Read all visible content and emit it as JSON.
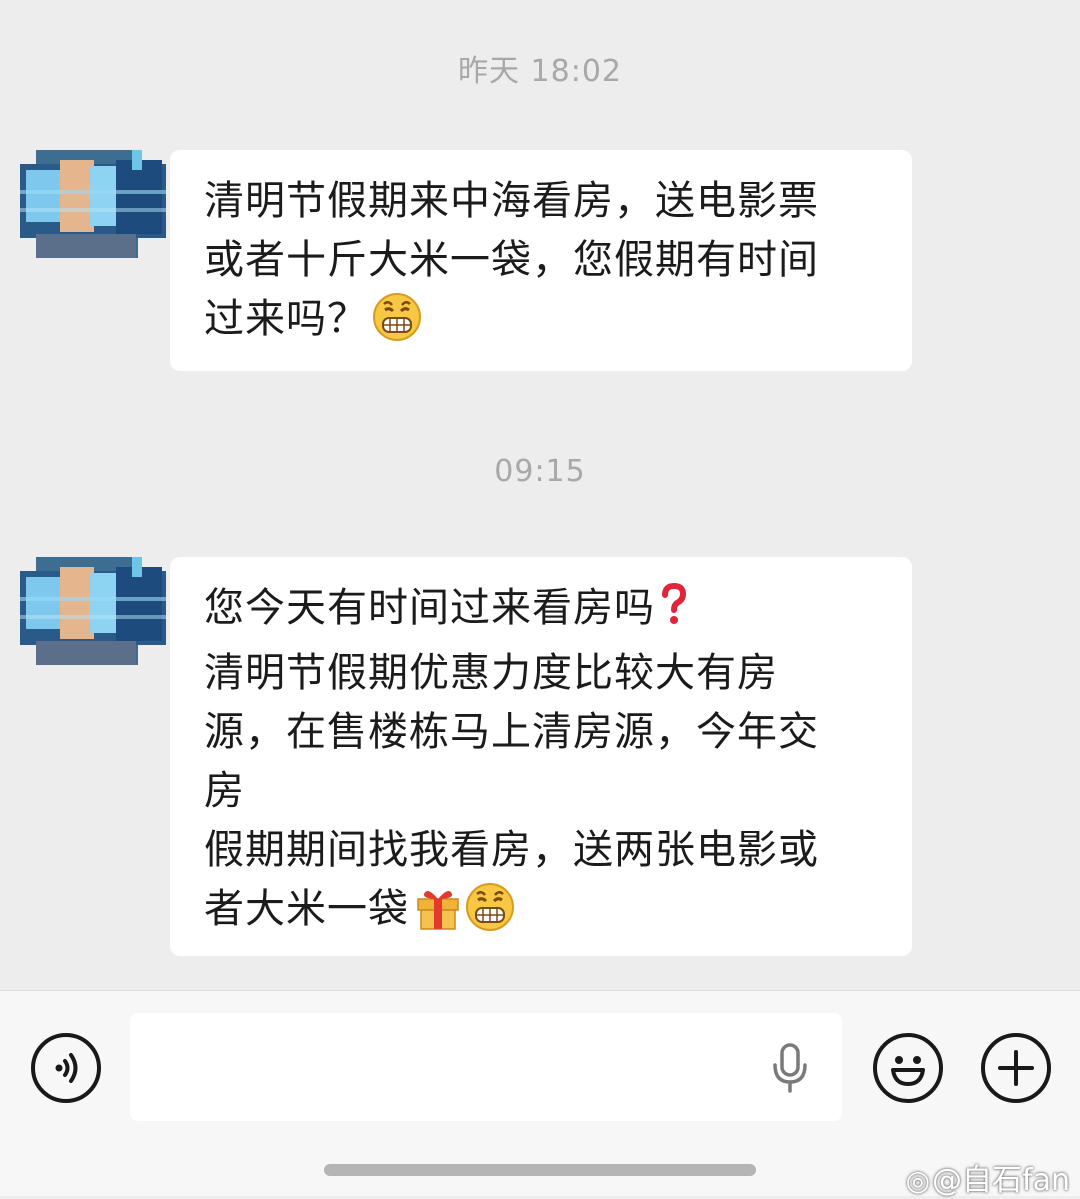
{
  "conversation": {
    "messages": [
      {
        "timestamp": "昨天 18:02",
        "text": "清明节假期来中海看房，送电影票\n或者十斤大米一袋，您假期有时间\n过来吗？",
        "emojis": [
          "grin-emoji"
        ]
      },
      {
        "timestamp": "09:15",
        "text": "您今天有时间过来看房吗",
        "text_2": "清明节假期优惠力度比较大有房\n源，在售楼栋马上清房源，今年交\n房\n假期期间找我看房，送两张电影或\n者大米一袋",
        "emojis": [
          "red-question-mark-emoji",
          "gift-emoji",
          "grin-emoji"
        ]
      }
    ]
  },
  "input_bar": {
    "voice_icon": "voice-toggle-icon",
    "mic_icon": "microphone-icon",
    "emoji_icon": "smiley-icon",
    "add_icon": "plus-icon",
    "placeholder": ""
  },
  "watermark": {
    "text": "@自石fan",
    "icon": "weibo-icon"
  },
  "colors": {
    "background": "#ededed",
    "bubble": "#ffffff",
    "text": "#1b1b1b",
    "timestamp": "#a8a8a8",
    "bar": "#f7f7f7"
  }
}
